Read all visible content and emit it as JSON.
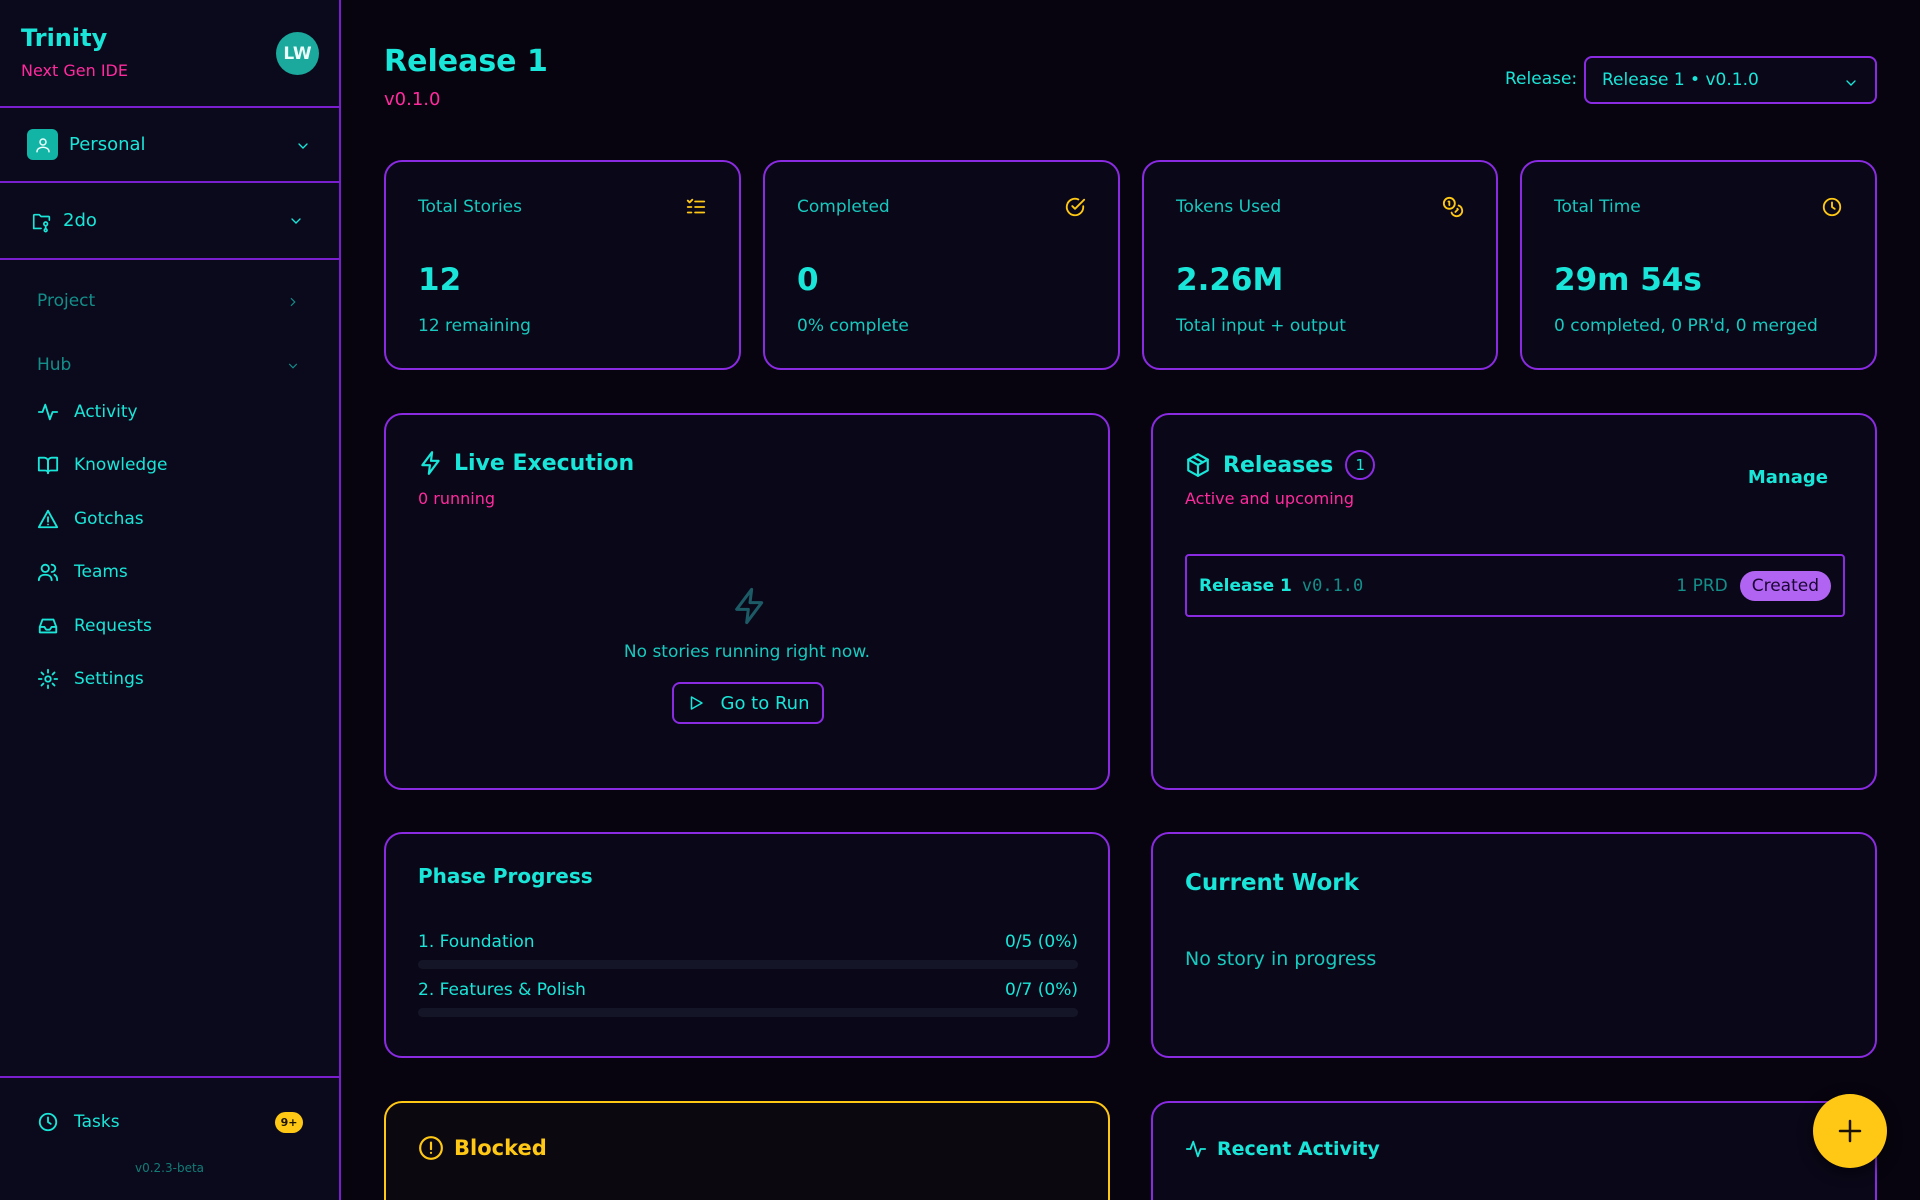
{
  "colors": {
    "background": "#07040f",
    "cyan": "#19e6d8",
    "pink": "#ff2a9d",
    "purple": "#8a2be2",
    "yellow": "#ffc815",
    "status_created": "#b163f2"
  },
  "sidebar": {
    "brand_title": "Trinity",
    "brand_subtitle": "Next Gen IDE",
    "avatar_initials": "LW",
    "workspace": {
      "label": "Personal",
      "icon": "user-icon"
    },
    "project": {
      "label": "2do",
      "icon": "folder-git-icon"
    },
    "sections": [
      {
        "label": "Project",
        "state": "collapsed"
      },
      {
        "label": "Hub",
        "state": "expanded"
      }
    ],
    "hub_items": [
      {
        "label": "Activity",
        "icon": "activity-icon"
      },
      {
        "label": "Knowledge",
        "icon": "book-icon"
      },
      {
        "label": "Gotchas",
        "icon": "warning-icon"
      },
      {
        "label": "Teams",
        "icon": "users-icon"
      },
      {
        "label": "Requests",
        "icon": "inbox-icon"
      },
      {
        "label": "Settings",
        "icon": "gear-icon"
      }
    ],
    "footer": {
      "tasks_label": "Tasks",
      "tasks_badge": "9+",
      "version": "v0.2.3-beta"
    }
  },
  "header": {
    "title": "Release 1",
    "version": "v0.1.0",
    "release_label": "Release:",
    "release_selected": "Release 1 • v0.1.0"
  },
  "stats": [
    {
      "title": "Total Stories",
      "value": "12",
      "sub": "12 remaining",
      "icon": "list-todo-icon"
    },
    {
      "title": "Completed",
      "value": "0",
      "sub": "0% complete",
      "icon": "check-circle-icon"
    },
    {
      "title": "Tokens Used",
      "value": "2.26M",
      "sub": "Total input + output",
      "icon": "coins-icon"
    },
    {
      "title": "Total Time",
      "value": "29m 54s",
      "sub": "0 completed, 0 PR'd, 0 merged",
      "icon": "clock-icon"
    }
  ],
  "live_execution": {
    "title": "Live Execution",
    "running": "0 running",
    "empty_text": "No stories running right now.",
    "button_label": "Go to Run"
  },
  "releases": {
    "title": "Releases",
    "count": "1",
    "subtitle": "Active and upcoming",
    "manage_label": "Manage",
    "items": [
      {
        "name": "Release 1",
        "version": "v0.1.0",
        "prd_count": "1 PRD",
        "status": "Created"
      }
    ]
  },
  "phase_progress": {
    "title": "Phase Progress",
    "phases": [
      {
        "label": "1. Foundation",
        "progress_text": "0/5 (0%)",
        "fraction": 0
      },
      {
        "label": "2. Features & Polish",
        "progress_text": "0/7 (0%)",
        "fraction": 0
      }
    ]
  },
  "current_work": {
    "title": "Current Work",
    "empty_text": "No story in progress"
  },
  "blocked": {
    "title": "Blocked"
  },
  "recent_activity": {
    "title": "Recent Activity"
  },
  "fab": {
    "icon": "plus-icon"
  }
}
